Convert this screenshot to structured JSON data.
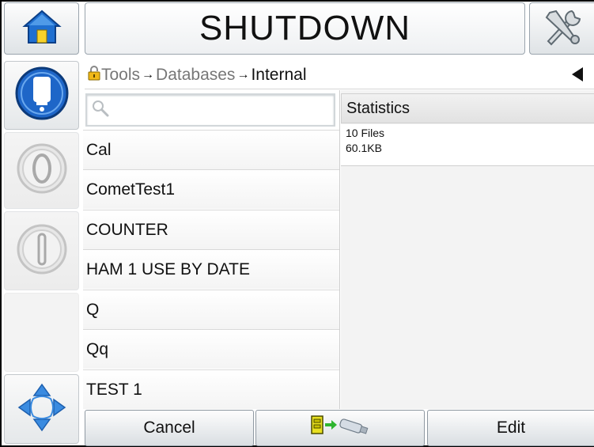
{
  "header": {
    "title": "SHUTDOWN",
    "home_icon": "home-icon",
    "tools_icon": "tools-icon"
  },
  "left_panel": {
    "buttons": [
      {
        "name": "ink-system-status",
        "icon": "ink-drop-icon"
      },
      {
        "name": "jet-start",
        "icon": "jet-on-icon"
      },
      {
        "name": "jet-stop",
        "icon": "jet-off-icon"
      },
      {
        "name": "empty-slot",
        "icon": ""
      },
      {
        "name": "navigation",
        "icon": "navigation-arrows-icon"
      }
    ]
  },
  "breadcrumb": {
    "items": [
      "Tools",
      "Databases",
      "Internal"
    ],
    "separator": "→"
  },
  "search": {
    "placeholder": "",
    "value": ""
  },
  "databases": [
    "Cal",
    "CometTest1",
    "COUNTER",
    "HAM 1 USE BY DATE",
    "Q",
    "Qq",
    "TEST 1"
  ],
  "statistics": {
    "title": "Statistics",
    "files": "10 Files",
    "size": "60.1KB"
  },
  "footer": {
    "cancel_label": "Cancel",
    "export_icon": "export-to-usb-icon",
    "edit_label": "Edit"
  },
  "colors": {
    "accent_blue": "#1e66c8",
    "arrow_green": "#2fb52f",
    "lock_yellow": "#f0b818"
  }
}
